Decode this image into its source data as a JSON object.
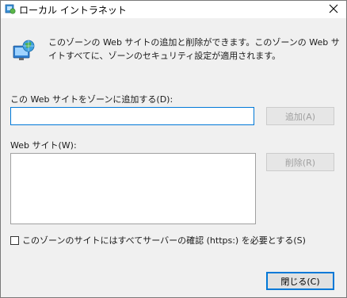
{
  "window": {
    "title": "ローカル イントラネット"
  },
  "description": "このゾーンの Web サイトの追加と削除ができます。このゾーンの Web サイトすべてに、ゾーンのセキュリティ設定が適用されます。",
  "add_site": {
    "label": "この Web サイトをゾーンに追加する(D):",
    "value": "",
    "button_label": "追加(A)"
  },
  "sites": {
    "label": "Web サイト(W):",
    "items": [],
    "remove_label": "削除(R)"
  },
  "require_https": {
    "label": "このゾーンのサイトにはすべてサーバーの確認 (https:) を必要とする(S)",
    "checked": false
  },
  "footer": {
    "close_label": "閉じる(C)"
  },
  "colors": {
    "accent": "#0078d7",
    "disabled_text": "#a0a0a0"
  }
}
